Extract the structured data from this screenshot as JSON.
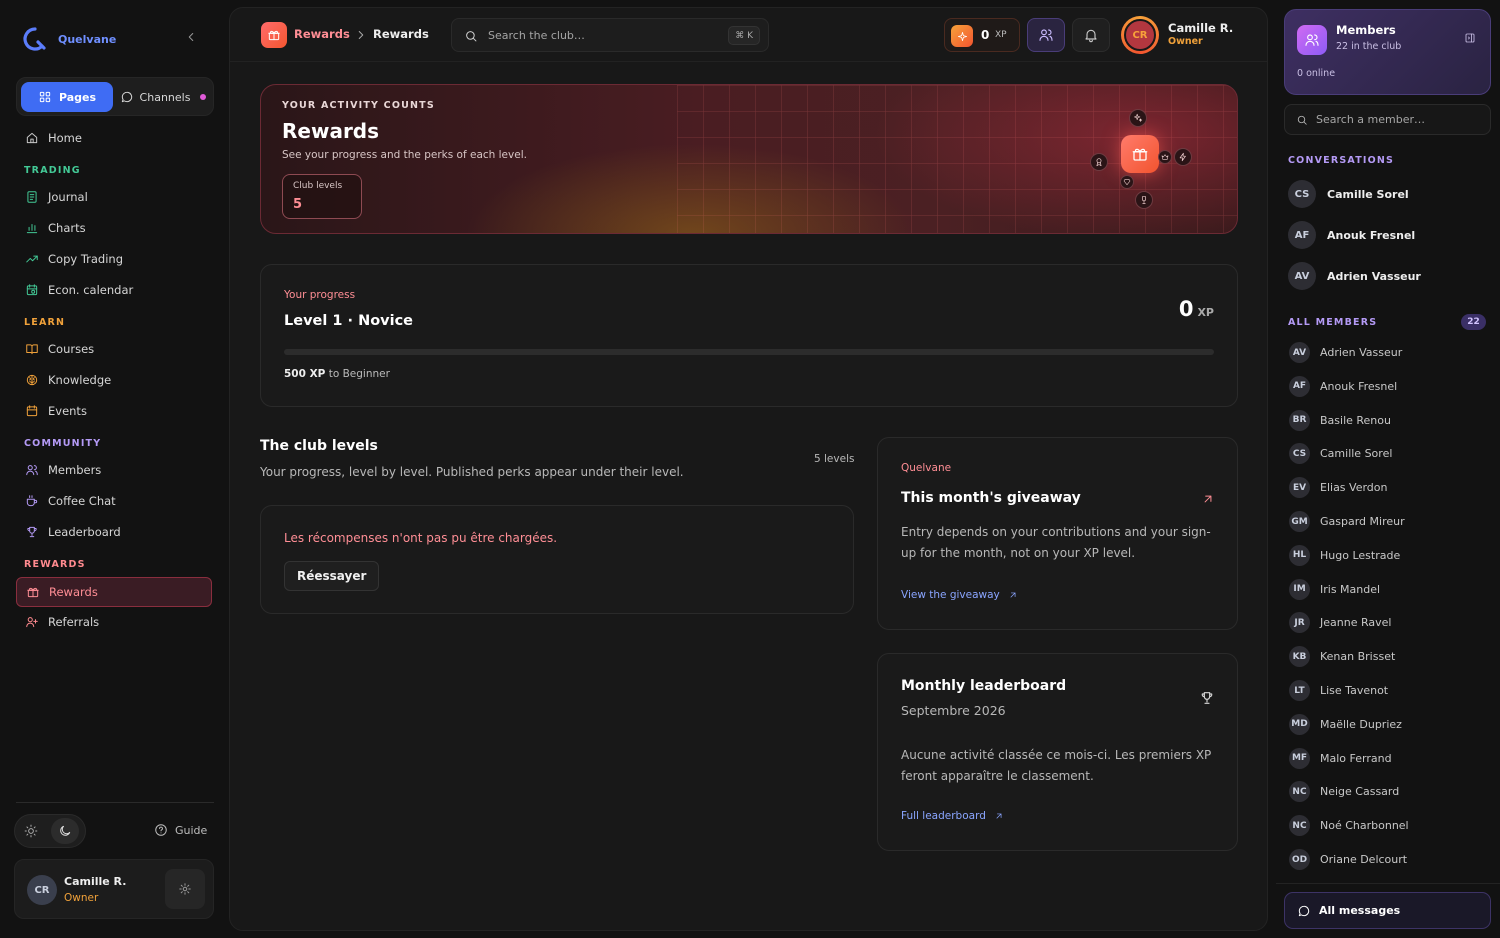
{
  "brand": {
    "name": "Quelvane"
  },
  "sidebar": {
    "tabs": {
      "pages": "Pages",
      "channels": "Channels"
    },
    "home": "Home",
    "sections": {
      "trading": "TRADING",
      "learn": "LEARN",
      "community": "COMMUNITY",
      "rewards": "REWARDS"
    },
    "trading": [
      "Journal",
      "Charts",
      "Copy Trading",
      "Econ. calendar"
    ],
    "learn": [
      "Courses",
      "Knowledge",
      "Events"
    ],
    "community": [
      "Members",
      "Coffee Chat",
      "Leaderboard"
    ],
    "rewards": [
      "Rewards",
      "Referrals"
    ],
    "guide": "Guide",
    "user": {
      "initials": "CR",
      "name": "Camille R.",
      "role": "Owner"
    }
  },
  "topbar": {
    "breadcrumb": [
      "Rewards",
      "Rewards"
    ],
    "search_placeholder": "Search the club…",
    "search_shortcut": "⌘ K",
    "xp_value": "0",
    "xp_unit": "XP",
    "user": {
      "initials": "CR",
      "name": "Camille R.",
      "role": "Owner"
    }
  },
  "hero": {
    "eyebrow": "YOUR ACTIVITY COUNTS",
    "title": "Rewards",
    "subtitle": "See your progress and the perks of each level.",
    "chip_label": "Club levels",
    "chip_value": "5"
  },
  "progress": {
    "label": "Your progress",
    "level": "Level 1 · Novice",
    "xp_value": "0",
    "xp_unit": "XP",
    "fraction": 0,
    "next_xp": "500 XP",
    "next_label": "to Beginner"
  },
  "levels": {
    "title": "The club levels",
    "subtitle": "Your progress, level by level. Published perks appear under their level.",
    "count": "5 levels",
    "error": "Les récompenses n'ont pas pu être chargées.",
    "retry": "Réessayer"
  },
  "giveaway": {
    "eyebrow": "Quelvane",
    "title": "This month's giveaway",
    "body": "Entry depends on your contributions and your sign-up for the month, not on your XP level.",
    "link": "View the giveaway"
  },
  "leaderboard": {
    "title": "Monthly leaderboard",
    "month": "Septembre 2026",
    "body": "Aucune activité classée ce mois-ci. Les premiers XP feront apparaître le classement.",
    "link": "Full leaderboard"
  },
  "rightbar": {
    "title": "Members",
    "subtitle": "22 in the club",
    "online": "0 online",
    "search_placeholder": "Search a member…",
    "conversations_label": "CONVERSATIONS",
    "conversations": [
      {
        "initials": "CS",
        "name": "Camille Sorel"
      },
      {
        "initials": "AF",
        "name": "Anouk Fresnel"
      },
      {
        "initials": "AV",
        "name": "Adrien Vasseur"
      }
    ],
    "all_members_label": "ALL MEMBERS",
    "all_members_count": "22",
    "members": [
      {
        "initials": "AV",
        "name": "Adrien Vasseur"
      },
      {
        "initials": "AF",
        "name": "Anouk Fresnel"
      },
      {
        "initials": "BR",
        "name": "Basile Renou"
      },
      {
        "initials": "CS",
        "name": "Camille Sorel"
      },
      {
        "initials": "EV",
        "name": "Elias Verdon"
      },
      {
        "initials": "GM",
        "name": "Gaspard Mireur"
      },
      {
        "initials": "HL",
        "name": "Hugo Lestrade"
      },
      {
        "initials": "IM",
        "name": "Iris Mandel"
      },
      {
        "initials": "JR",
        "name": "Jeanne Ravel"
      },
      {
        "initials": "KB",
        "name": "Kenan Brisset"
      },
      {
        "initials": "LT",
        "name": "Lise Tavenot"
      },
      {
        "initials": "MD",
        "name": "Maëlle Dupriez"
      },
      {
        "initials": "MF",
        "name": "Malo Ferrand"
      },
      {
        "initials": "NC",
        "name": "Neige Cassard"
      },
      {
        "initials": "NC",
        "name": "Noé Charbonnel"
      },
      {
        "initials": "OD",
        "name": "Oriane Delcourt"
      }
    ],
    "all_messages": "All messages"
  },
  "colors": {
    "accent": "#ff8e95",
    "primary_blue": "#3f6cf4",
    "trading": "#43c996",
    "learn": "#f0a13a",
    "community": "#b49af5",
    "rewards": "#ff8a8f",
    "role": "#f0a13a"
  }
}
